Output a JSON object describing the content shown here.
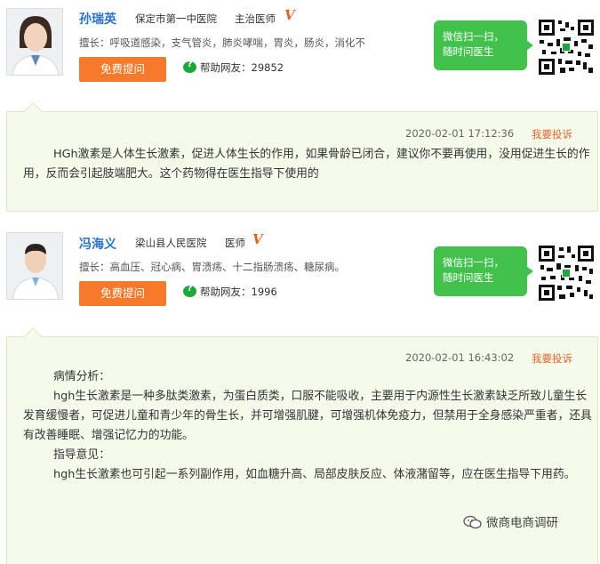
{
  "doctors": [
    {
      "name": "孙瑞英",
      "hospital": "保定市第一中医院",
      "title": "主治医师",
      "verified_mark": "V",
      "specialty": "擅长：呼吸道感染，支气管炎，肺炎哮喘，胃炎，肠炎，消化不",
      "consult_button": "免费提问",
      "helped_label": "帮助网友：",
      "helped_count": "29852",
      "wechat_text": [
        "微信扫一扫，",
        "随时问医生"
      ],
      "answer": {
        "timestamp": "2020-02-01 17:12:36",
        "report_label": "我要投诉",
        "paragraphs": [
          "HGh激素是人体生长激素，促进人体生长的作用，如果骨龄已闭合，建议你不要再使用，没用促进生长的作用，反而会引起肢端肥大。这个药物得在医生指导下使用的"
        ]
      }
    },
    {
      "name": "冯海义",
      "hospital": "梁山县人民医院",
      "title": "医师",
      "verified_mark": "V",
      "specialty": "擅长：高血压、冠心病、胃溃疡、十二指肠溃疡、糖尿病。",
      "consult_button": "免费提问",
      "helped_label": "帮助网友：",
      "helped_count": "1996",
      "wechat_text": [
        "微信扫一扫，",
        "随时问医生"
      ],
      "answer": {
        "timestamp": "2020-02-01 16:43:02",
        "report_label": "我要投诉",
        "analysis_heading": "病情分析：",
        "analysis_text": "hgh生长激素是一种多肽类激素，为蛋白质类，口服不能吸收，主要用于内源性生长激素缺乏所致儿童生长发育缓慢者，可促进儿童和青少年的骨生长，并可增强肌腱，可增强机体免疫力，但禁用于全身感染严重者，还具有改善睡眠、增强记忆力的功能。",
        "advice_heading": "指导意见：",
        "advice_text": "hgh生长激素也可引起一系列副作用，如血糖升高、局部皮肤反应、体液潴留等，应在医生指导下用药。"
      }
    }
  ],
  "watermark": "微商电商调研",
  "colors": {
    "name_blue": "#2a73c8",
    "button_orange": "#f7792b",
    "wechat_green": "#42c14d",
    "answer_bg": "#f4fbea",
    "report_orange": "#e8612c"
  }
}
